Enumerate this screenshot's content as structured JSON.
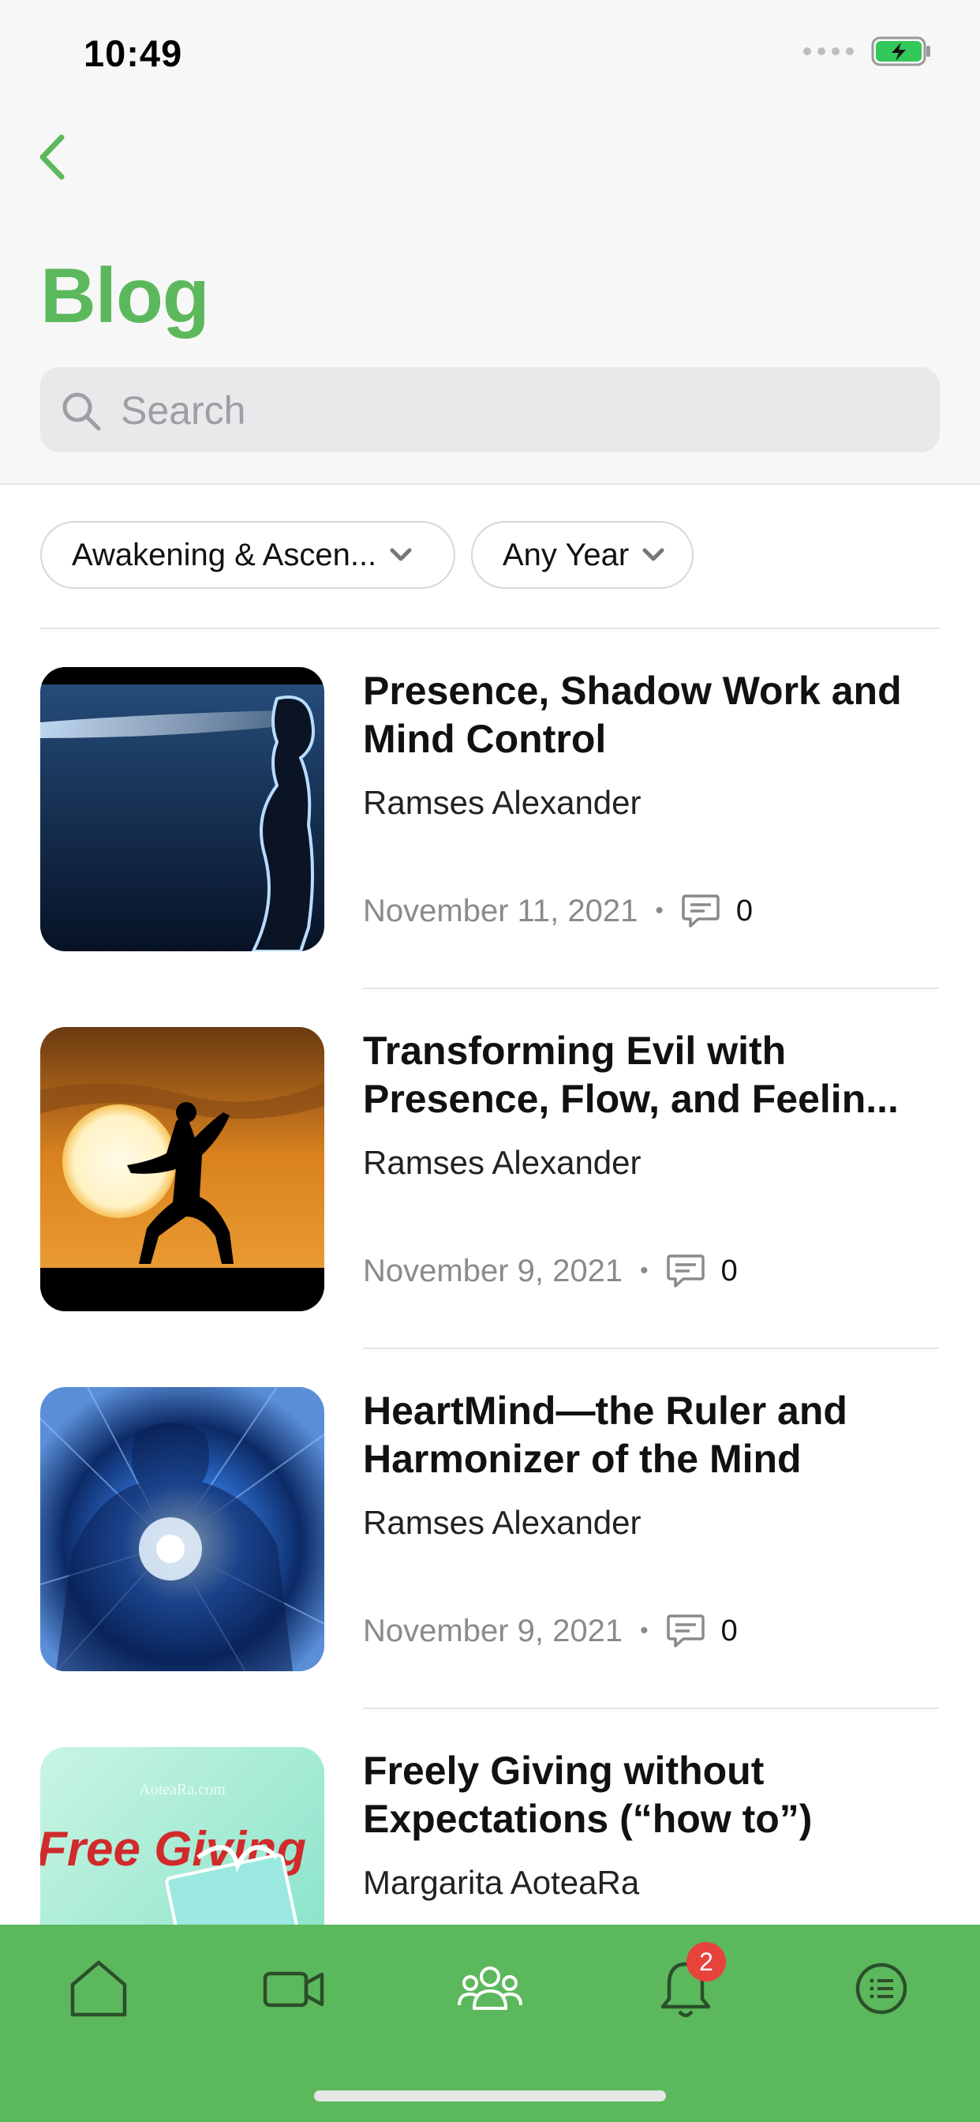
{
  "status_bar": {
    "time": "10:49"
  },
  "header": {
    "title": "Blog"
  },
  "search": {
    "placeholder": "Search",
    "value": ""
  },
  "filters": {
    "topic": "Awakening & Ascen...",
    "year": "Any Year"
  },
  "posts": [
    {
      "title": "Presence, Shadow Work and Mind Control",
      "author": "Ramses Alexander",
      "date": "November 11, 2021",
      "comments": "0",
      "thumb_icon": "glowing-figure-image"
    },
    {
      "title": "Transforming Evil with Presence, Flow, and Feelin...",
      "author": "Ramses Alexander",
      "date": "November 9, 2021",
      "comments": "0",
      "thumb_icon": "sunset-silhouette-image"
    },
    {
      "title": "HeartMind—the Ruler and Harmonizer of the Mind",
      "author": "Ramses Alexander",
      "date": "November 9, 2021",
      "comments": "0",
      "thumb_icon": "heart-light-image"
    },
    {
      "title": "Freely Giving without Expectations (“how to”)",
      "author": "Margarita AoteaRa",
      "date": "",
      "comments": "",
      "thumb_icon": "free-giving-image",
      "thumb_text": "Free Giving",
      "thumb_watermark": "AoteaRa.com"
    }
  ],
  "tabbar": {
    "items": [
      "home-icon",
      "video-icon",
      "groups-icon",
      "bell-icon",
      "menu-list-icon"
    ],
    "notifications_badge": "2"
  },
  "colors": {
    "accent": "#5cb85c",
    "badge": "#e8423c",
    "meta_text": "#8a8a8e"
  }
}
